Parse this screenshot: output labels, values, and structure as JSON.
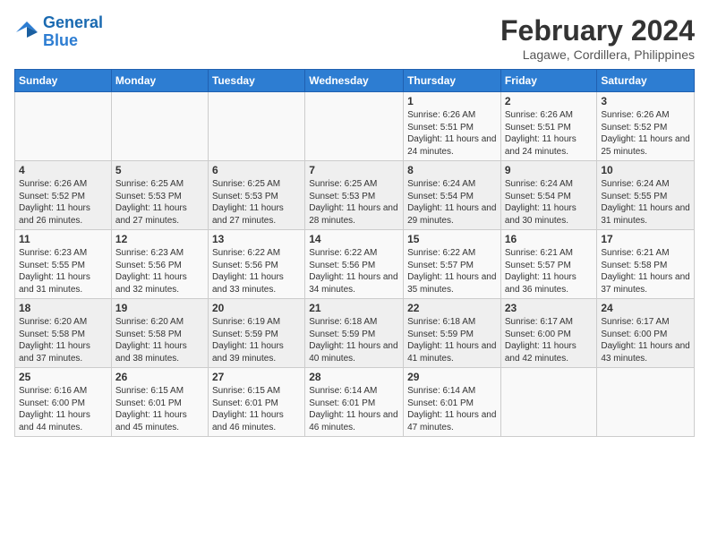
{
  "logo": {
    "line1": "General",
    "line2": "Blue"
  },
  "title": {
    "month_year": "February 2024",
    "location": "Lagawe, Cordillera, Philippines"
  },
  "days_of_week": [
    "Sunday",
    "Monday",
    "Tuesday",
    "Wednesday",
    "Thursday",
    "Friday",
    "Saturday"
  ],
  "weeks": [
    [
      {
        "day": "",
        "info": ""
      },
      {
        "day": "",
        "info": ""
      },
      {
        "day": "",
        "info": ""
      },
      {
        "day": "",
        "info": ""
      },
      {
        "day": "1",
        "info": "Sunrise: 6:26 AM\nSunset: 5:51 PM\nDaylight: 11 hours\nand 24 minutes."
      },
      {
        "day": "2",
        "info": "Sunrise: 6:26 AM\nSunset: 5:51 PM\nDaylight: 11 hours\nand 24 minutes."
      },
      {
        "day": "3",
        "info": "Sunrise: 6:26 AM\nSunset: 5:52 PM\nDaylight: 11 hours\nand 25 minutes."
      }
    ],
    [
      {
        "day": "4",
        "info": "Sunrise: 6:26 AM\nSunset: 5:52 PM\nDaylight: 11 hours\nand 26 minutes."
      },
      {
        "day": "5",
        "info": "Sunrise: 6:25 AM\nSunset: 5:53 PM\nDaylight: 11 hours\nand 27 minutes."
      },
      {
        "day": "6",
        "info": "Sunrise: 6:25 AM\nSunset: 5:53 PM\nDaylight: 11 hours\nand 27 minutes."
      },
      {
        "day": "7",
        "info": "Sunrise: 6:25 AM\nSunset: 5:53 PM\nDaylight: 11 hours\nand 28 minutes."
      },
      {
        "day": "8",
        "info": "Sunrise: 6:24 AM\nSunset: 5:54 PM\nDaylight: 11 hours\nand 29 minutes."
      },
      {
        "day": "9",
        "info": "Sunrise: 6:24 AM\nSunset: 5:54 PM\nDaylight: 11 hours\nand 30 minutes."
      },
      {
        "day": "10",
        "info": "Sunrise: 6:24 AM\nSunset: 5:55 PM\nDaylight: 11 hours\nand 31 minutes."
      }
    ],
    [
      {
        "day": "11",
        "info": "Sunrise: 6:23 AM\nSunset: 5:55 PM\nDaylight: 11 hours\nand 31 minutes."
      },
      {
        "day": "12",
        "info": "Sunrise: 6:23 AM\nSunset: 5:56 PM\nDaylight: 11 hours\nand 32 minutes."
      },
      {
        "day": "13",
        "info": "Sunrise: 6:22 AM\nSunset: 5:56 PM\nDaylight: 11 hours\nand 33 minutes."
      },
      {
        "day": "14",
        "info": "Sunrise: 6:22 AM\nSunset: 5:56 PM\nDaylight: 11 hours\nand 34 minutes."
      },
      {
        "day": "15",
        "info": "Sunrise: 6:22 AM\nSunset: 5:57 PM\nDaylight: 11 hours\nand 35 minutes."
      },
      {
        "day": "16",
        "info": "Sunrise: 6:21 AM\nSunset: 5:57 PM\nDaylight: 11 hours\nand 36 minutes."
      },
      {
        "day": "17",
        "info": "Sunrise: 6:21 AM\nSunset: 5:58 PM\nDaylight: 11 hours\nand 37 minutes."
      }
    ],
    [
      {
        "day": "18",
        "info": "Sunrise: 6:20 AM\nSunset: 5:58 PM\nDaylight: 11 hours\nand 37 minutes."
      },
      {
        "day": "19",
        "info": "Sunrise: 6:20 AM\nSunset: 5:58 PM\nDaylight: 11 hours\nand 38 minutes."
      },
      {
        "day": "20",
        "info": "Sunrise: 6:19 AM\nSunset: 5:59 PM\nDaylight: 11 hours\nand 39 minutes."
      },
      {
        "day": "21",
        "info": "Sunrise: 6:18 AM\nSunset: 5:59 PM\nDaylight: 11 hours\nand 40 minutes."
      },
      {
        "day": "22",
        "info": "Sunrise: 6:18 AM\nSunset: 5:59 PM\nDaylight: 11 hours\nand 41 minutes."
      },
      {
        "day": "23",
        "info": "Sunrise: 6:17 AM\nSunset: 6:00 PM\nDaylight: 11 hours\nand 42 minutes."
      },
      {
        "day": "24",
        "info": "Sunrise: 6:17 AM\nSunset: 6:00 PM\nDaylight: 11 hours\nand 43 minutes."
      }
    ],
    [
      {
        "day": "25",
        "info": "Sunrise: 6:16 AM\nSunset: 6:00 PM\nDaylight: 11 hours\nand 44 minutes."
      },
      {
        "day": "26",
        "info": "Sunrise: 6:15 AM\nSunset: 6:01 PM\nDaylight: 11 hours\nand 45 minutes."
      },
      {
        "day": "27",
        "info": "Sunrise: 6:15 AM\nSunset: 6:01 PM\nDaylight: 11 hours\nand 46 minutes."
      },
      {
        "day": "28",
        "info": "Sunrise: 6:14 AM\nSunset: 6:01 PM\nDaylight: 11 hours\nand 46 minutes."
      },
      {
        "day": "29",
        "info": "Sunrise: 6:14 AM\nSunset: 6:01 PM\nDaylight: 11 hours\nand 47 minutes."
      },
      {
        "day": "",
        "info": ""
      },
      {
        "day": "",
        "info": ""
      }
    ]
  ]
}
